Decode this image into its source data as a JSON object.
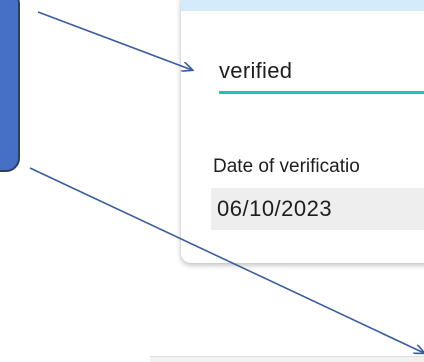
{
  "verification": {
    "status_value": "verified",
    "date_label": "Date of verificatio",
    "date_value": "06/10/2023"
  },
  "colors": {
    "underline_accent": "#1fc6b8",
    "callout_fill": "#4670c3",
    "arrow": "#3a5e9a",
    "card_band": "#d3ebfb"
  }
}
